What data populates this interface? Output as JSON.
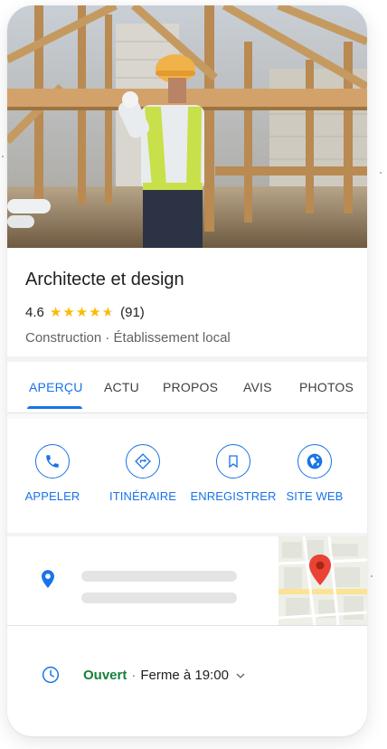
{
  "business": {
    "name": "Architecte et design",
    "rating": "4.6",
    "stars": 4.6,
    "review_count": "(91)",
    "category": "Construction · Établissement local"
  },
  "tabs": [
    {
      "label": "APERÇU",
      "active": true
    },
    {
      "label": "ACTU",
      "active": false
    },
    {
      "label": "PROPOS",
      "active": false
    },
    {
      "label": "AVIS",
      "active": false
    },
    {
      "label": "PHOTOS",
      "active": false
    }
  ],
  "actions": [
    {
      "label": "APPELER",
      "icon": "phone-icon"
    },
    {
      "label": "ITINÉRAIRE",
      "icon": "directions-icon"
    },
    {
      "label": "ENREGISTRER",
      "icon": "bookmark-icon"
    },
    {
      "label": "SITE WEB",
      "icon": "globe-icon"
    }
  ],
  "hours": {
    "status": "Ouvert",
    "separator": "·",
    "closing": "Ferme à 19:00"
  },
  "colors": {
    "accent": "#1a73e8",
    "star": "#fbbc04",
    "open": "#188038",
    "map_pin": "#ea4335"
  }
}
